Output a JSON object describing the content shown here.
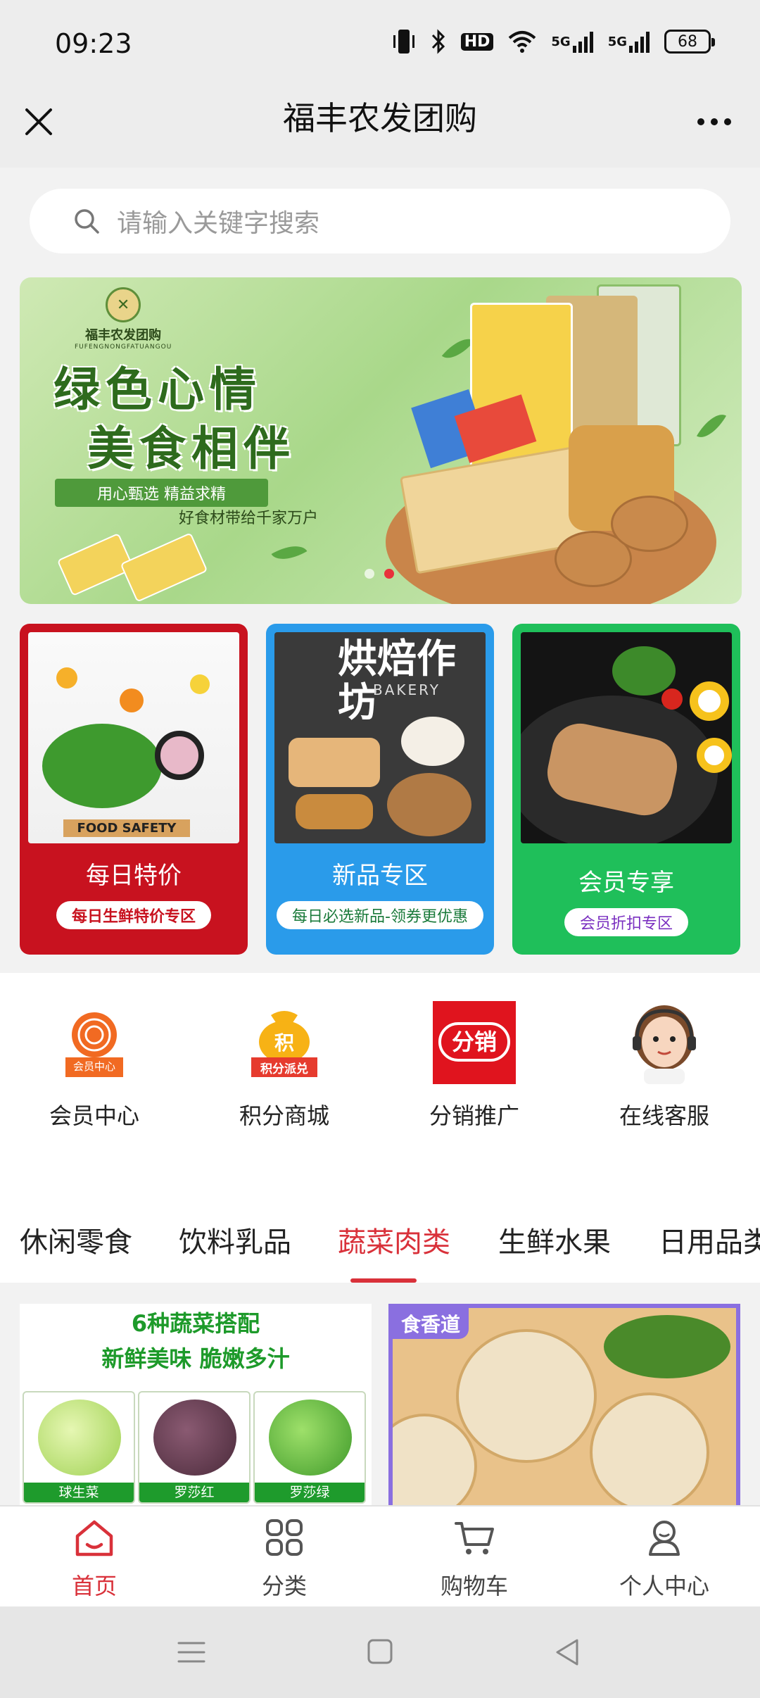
{
  "status_bar": {
    "time": "09:23",
    "battery": "68",
    "icons": [
      "vibrate-icon",
      "bluetooth-icon",
      "hd-icon",
      "wifi-icon",
      "signal-5g-icon",
      "signal-5g-icon",
      "battery-icon"
    ],
    "hd": "HD",
    "net1": "5G",
    "net2": "5G"
  },
  "title_bar": {
    "title": "福丰农发团购"
  },
  "search": {
    "placeholder": "请输入关键字搜索"
  },
  "banner": {
    "logo_text": "福丰农发团购",
    "logo_sub": "FUFENGNONGFATUANGOU",
    "title_line1": "绿色心情",
    "title_line2": "美食相伴",
    "tagline": "用心甄选  精益求精",
    "subline": "好食材带给千家万户",
    "slide_count": 2,
    "active_slide": 2
  },
  "promos": [
    {
      "title": "每日特价",
      "subtitle": "每日生鲜特价专区",
      "image_text": "FOOD SAFETY"
    },
    {
      "title": "新品专区",
      "subtitle": "每日必选新品-领券更优惠",
      "image_text": "烘焙作坊",
      "image_sub": "BAKERY"
    },
    {
      "title": "会员专享",
      "subtitle": "会员折扣专区"
    }
  ],
  "quick_entries": [
    {
      "label": "会员中心",
      "icon": "member-center-icon",
      "badge": "会员中心"
    },
    {
      "label": "积分商城",
      "icon": "points-mall-icon",
      "badge": "积分派兑",
      "symbol": "积"
    },
    {
      "label": "分销推广",
      "icon": "distribution-icon",
      "badge": "分销"
    },
    {
      "label": "在线客服",
      "icon": "customer-service-icon"
    }
  ],
  "category_tabs": {
    "items": [
      "休闲零食",
      "饮料乳品",
      "蔬菜肉类",
      "生鲜水果",
      "日用品类"
    ],
    "active_index": 2
  },
  "products": [
    {
      "headline1": "6种蔬菜搭配",
      "headline2": "新鲜美味 脆嫩多汁",
      "vegetables": [
        "球生菜",
        "罗莎红",
        "罗莎绿"
      ]
    },
    {
      "brand": "食香道"
    }
  ],
  "bottom_nav": {
    "items": [
      {
        "label": "首页",
        "icon": "home-icon"
      },
      {
        "label": "分类",
        "icon": "category-grid-icon"
      },
      {
        "label": "购物车",
        "icon": "cart-icon"
      },
      {
        "label": "个人中心",
        "icon": "profile-icon"
      }
    ],
    "active_index": 0
  },
  "colors": {
    "accent_red": "#d9313a",
    "promo_red": "#c8121f",
    "promo_blue": "#2a9bea",
    "promo_green": "#1fbf5a",
    "veg_green": "#1e9b2c"
  },
  "system_nav": {
    "buttons": [
      "menu-icon",
      "home-square-icon",
      "back-triangle-icon"
    ]
  }
}
